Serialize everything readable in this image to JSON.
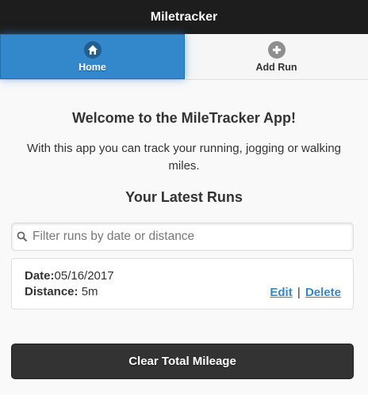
{
  "header": {
    "title": "Miletracker"
  },
  "nav": {
    "home_label": "Home",
    "home_icon": "home-icon",
    "add_run_label": "Add Run",
    "add_run_icon": "plus-circle-icon"
  },
  "main": {
    "welcome": "Welcome to the MileTracker App!",
    "description": "With this app you can track your running, jogging or walking miles.",
    "latest_heading": "Your Latest Runs"
  },
  "search": {
    "placeholder": "Filter runs by date or distance",
    "value": ""
  },
  "runs": [
    {
      "date_label": "Date:",
      "date": "05/16/2017",
      "distance_label": "Distance:",
      "distance": "5m",
      "edit_label": "Edit",
      "separator": "|",
      "delete_label": "Delete"
    }
  ],
  "footer": {
    "clear_label": "Clear Total Mileage"
  },
  "colors": {
    "accent": "#3388cc",
    "header_bg": "#1d1d1d",
    "button_bg": "#333333"
  }
}
